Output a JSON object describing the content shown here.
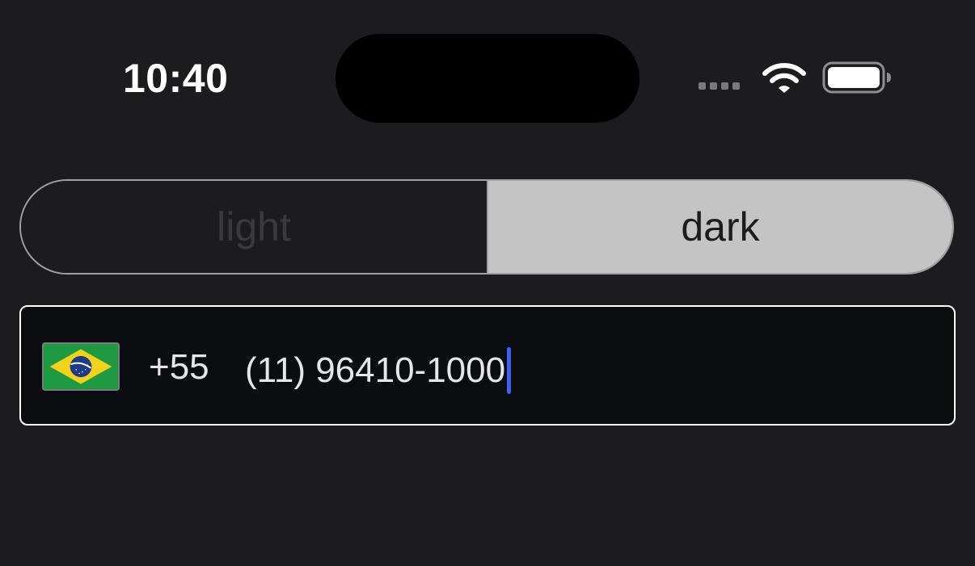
{
  "status_bar": {
    "time": "10:40",
    "icons": [
      "signal-dots-icon",
      "wifi-icon",
      "battery-icon"
    ]
  },
  "theme_toggle": {
    "options": [
      {
        "label": "light",
        "selected": false
      },
      {
        "label": "dark",
        "selected": true
      }
    ]
  },
  "phone_input": {
    "country_flag": "brazil-flag-icon",
    "dial_code": "+55",
    "value": "(11) 96410-1000"
  },
  "colors": {
    "background": "#1c1c1e",
    "selected_segment": "#c4c4c4",
    "field_background": "#0b0c10",
    "caret": "#3a64f0"
  }
}
